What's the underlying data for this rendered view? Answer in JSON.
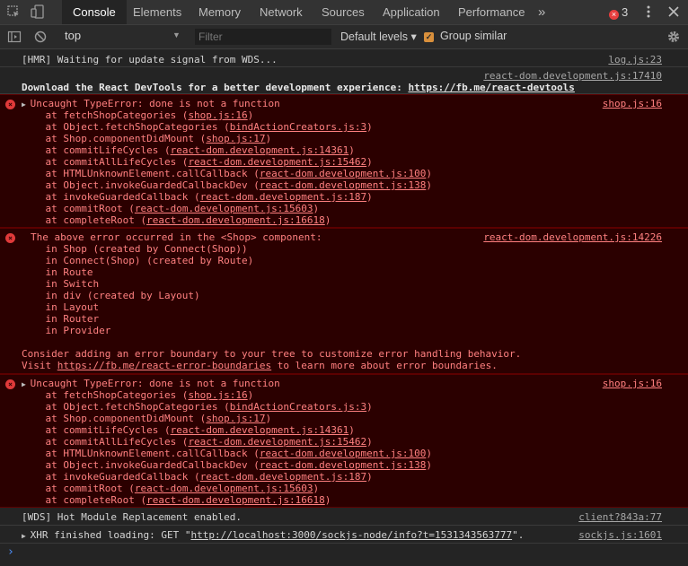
{
  "toolbar": {
    "tabs": [
      {
        "label": "Console",
        "active": true
      },
      {
        "label": "Elements"
      },
      {
        "label": "Memory"
      },
      {
        "label": "Network"
      },
      {
        "label": "Sources"
      },
      {
        "label": "Application"
      },
      {
        "label": "Performance"
      }
    ],
    "more_tabs": "»",
    "error_count": "3",
    "icons": [
      "inspect-icon",
      "device-toolbar-icon",
      "more-tabs-icon",
      "error-count-icon",
      "kebab-menu-icon",
      "close-icon"
    ]
  },
  "filterbar": {
    "context": "top",
    "filter_placeholder": "Filter",
    "levels": "Default levels ▾",
    "group_similar": "Group similar",
    "group_similar_checked": true,
    "icons": [
      "sidebar-toggle-icon",
      "clear-console-icon",
      "settings-icon"
    ]
  },
  "messages": {
    "hmr": {
      "text": "[HMR] Waiting for update signal from WDS...",
      "source": "log.js:23"
    },
    "devtools": {
      "source": "react-dom.development.js:17410",
      "text": "Download the React DevTools for a better development experience: ",
      "link": "https://fb.me/react-devtools"
    },
    "error1": {
      "source": "shop.js:16",
      "lines": [
        {
          "pre": "Uncaught TypeError: done is not a function",
          "link": "",
          "post": ""
        },
        {
          "pre": "    at fetchShopCategories (",
          "link": "shop.js:16",
          "post": ")"
        },
        {
          "pre": "    at Object.fetchShopCategories (",
          "link": "bindActionCreators.js:3",
          "post": ")"
        },
        {
          "pre": "    at Shop.componentDidMount (",
          "link": "shop.js:17",
          "post": ")"
        },
        {
          "pre": "    at commitLifeCycles (",
          "link": "react-dom.development.js:14361",
          "post": ")"
        },
        {
          "pre": "    at commitAllLifeCycles (",
          "link": "react-dom.development.js:15462",
          "post": ")"
        },
        {
          "pre": "    at HTMLUnknownElement.callCallback (",
          "link": "react-dom.development.js:100",
          "post": ")"
        },
        {
          "pre": "    at Object.invokeGuardedCallbackDev (",
          "link": "react-dom.development.js:138",
          "post": ")"
        },
        {
          "pre": "    at invokeGuardedCallback (",
          "link": "react-dom.development.js:187",
          "post": ")"
        },
        {
          "pre": "    at commitRoot (",
          "link": "react-dom.development.js:15603",
          "post": ")"
        },
        {
          "pre": "    at completeRoot (",
          "link": "react-dom.development.js:16618",
          "post": ")"
        }
      ]
    },
    "error2": {
      "source": "react-dom.development.js:14226",
      "lines": [
        {
          "pre": "The above error occurred in the <Shop> component:",
          "link": "",
          "post": ""
        },
        {
          "pre": "    in Shop (created by Connect(Shop))",
          "link": "",
          "post": ""
        },
        {
          "pre": "    in Connect(Shop) (created by Route)",
          "link": "",
          "post": ""
        },
        {
          "pre": "    in Route",
          "link": "",
          "post": ""
        },
        {
          "pre": "    in Switch",
          "link": "",
          "post": ""
        },
        {
          "pre": "    in div (created by Layout)",
          "link": "",
          "post": ""
        },
        {
          "pre": "    in Layout",
          "link": "",
          "post": ""
        },
        {
          "pre": "    in Router",
          "link": "",
          "post": ""
        },
        {
          "pre": "    in Provider",
          "link": "",
          "post": ""
        },
        {
          "pre": "",
          "link": "",
          "post": ""
        },
        {
          "pre": "Consider adding an error boundary to your tree to customize error handling behavior.",
          "link": "",
          "post": ""
        },
        {
          "pre": "Visit ",
          "link": "https://fb.me/react-error-boundaries",
          "post": " to learn more about error boundaries."
        }
      ]
    },
    "error3": {
      "source": "shop.js:16",
      "lines": [
        {
          "pre": "Uncaught TypeError: done is not a function",
          "link": "",
          "post": ""
        },
        {
          "pre": "    at fetchShopCategories (",
          "link": "shop.js:16",
          "post": ")"
        },
        {
          "pre": "    at Object.fetchShopCategories (",
          "link": "bindActionCreators.js:3",
          "post": ")"
        },
        {
          "pre": "    at Shop.componentDidMount (",
          "link": "shop.js:17",
          "post": ")"
        },
        {
          "pre": "    at commitLifeCycles (",
          "link": "react-dom.development.js:14361",
          "post": ")"
        },
        {
          "pre": "    at commitAllLifeCycles (",
          "link": "react-dom.development.js:15462",
          "post": ")"
        },
        {
          "pre": "    at HTMLUnknownElement.callCallback (",
          "link": "react-dom.development.js:100",
          "post": ")"
        },
        {
          "pre": "    at Object.invokeGuardedCallbackDev (",
          "link": "react-dom.development.js:138",
          "post": ")"
        },
        {
          "pre": "    at invokeGuardedCallback (",
          "link": "react-dom.development.js:187",
          "post": ")"
        },
        {
          "pre": "    at commitRoot (",
          "link": "react-dom.development.js:15603",
          "post": ")"
        },
        {
          "pre": "    at completeRoot (",
          "link": "react-dom.development.js:16618",
          "post": ")"
        }
      ]
    },
    "wds": {
      "text": "[WDS] Hot Module Replacement enabled.",
      "source": "client?843a:77"
    },
    "xhr": {
      "text": "XHR finished loading: GET \"",
      "link": "http://localhost:3000/sockjs-node/info?t=1531343563777",
      "post": "\".",
      "source": "sockjs.js:1601"
    }
  },
  "prompt": "›",
  "colors": {
    "error_bg": "#2b0000",
    "error_text": "#ff8080",
    "accent": "#4d90fe",
    "checkbox": "#d9903c"
  }
}
